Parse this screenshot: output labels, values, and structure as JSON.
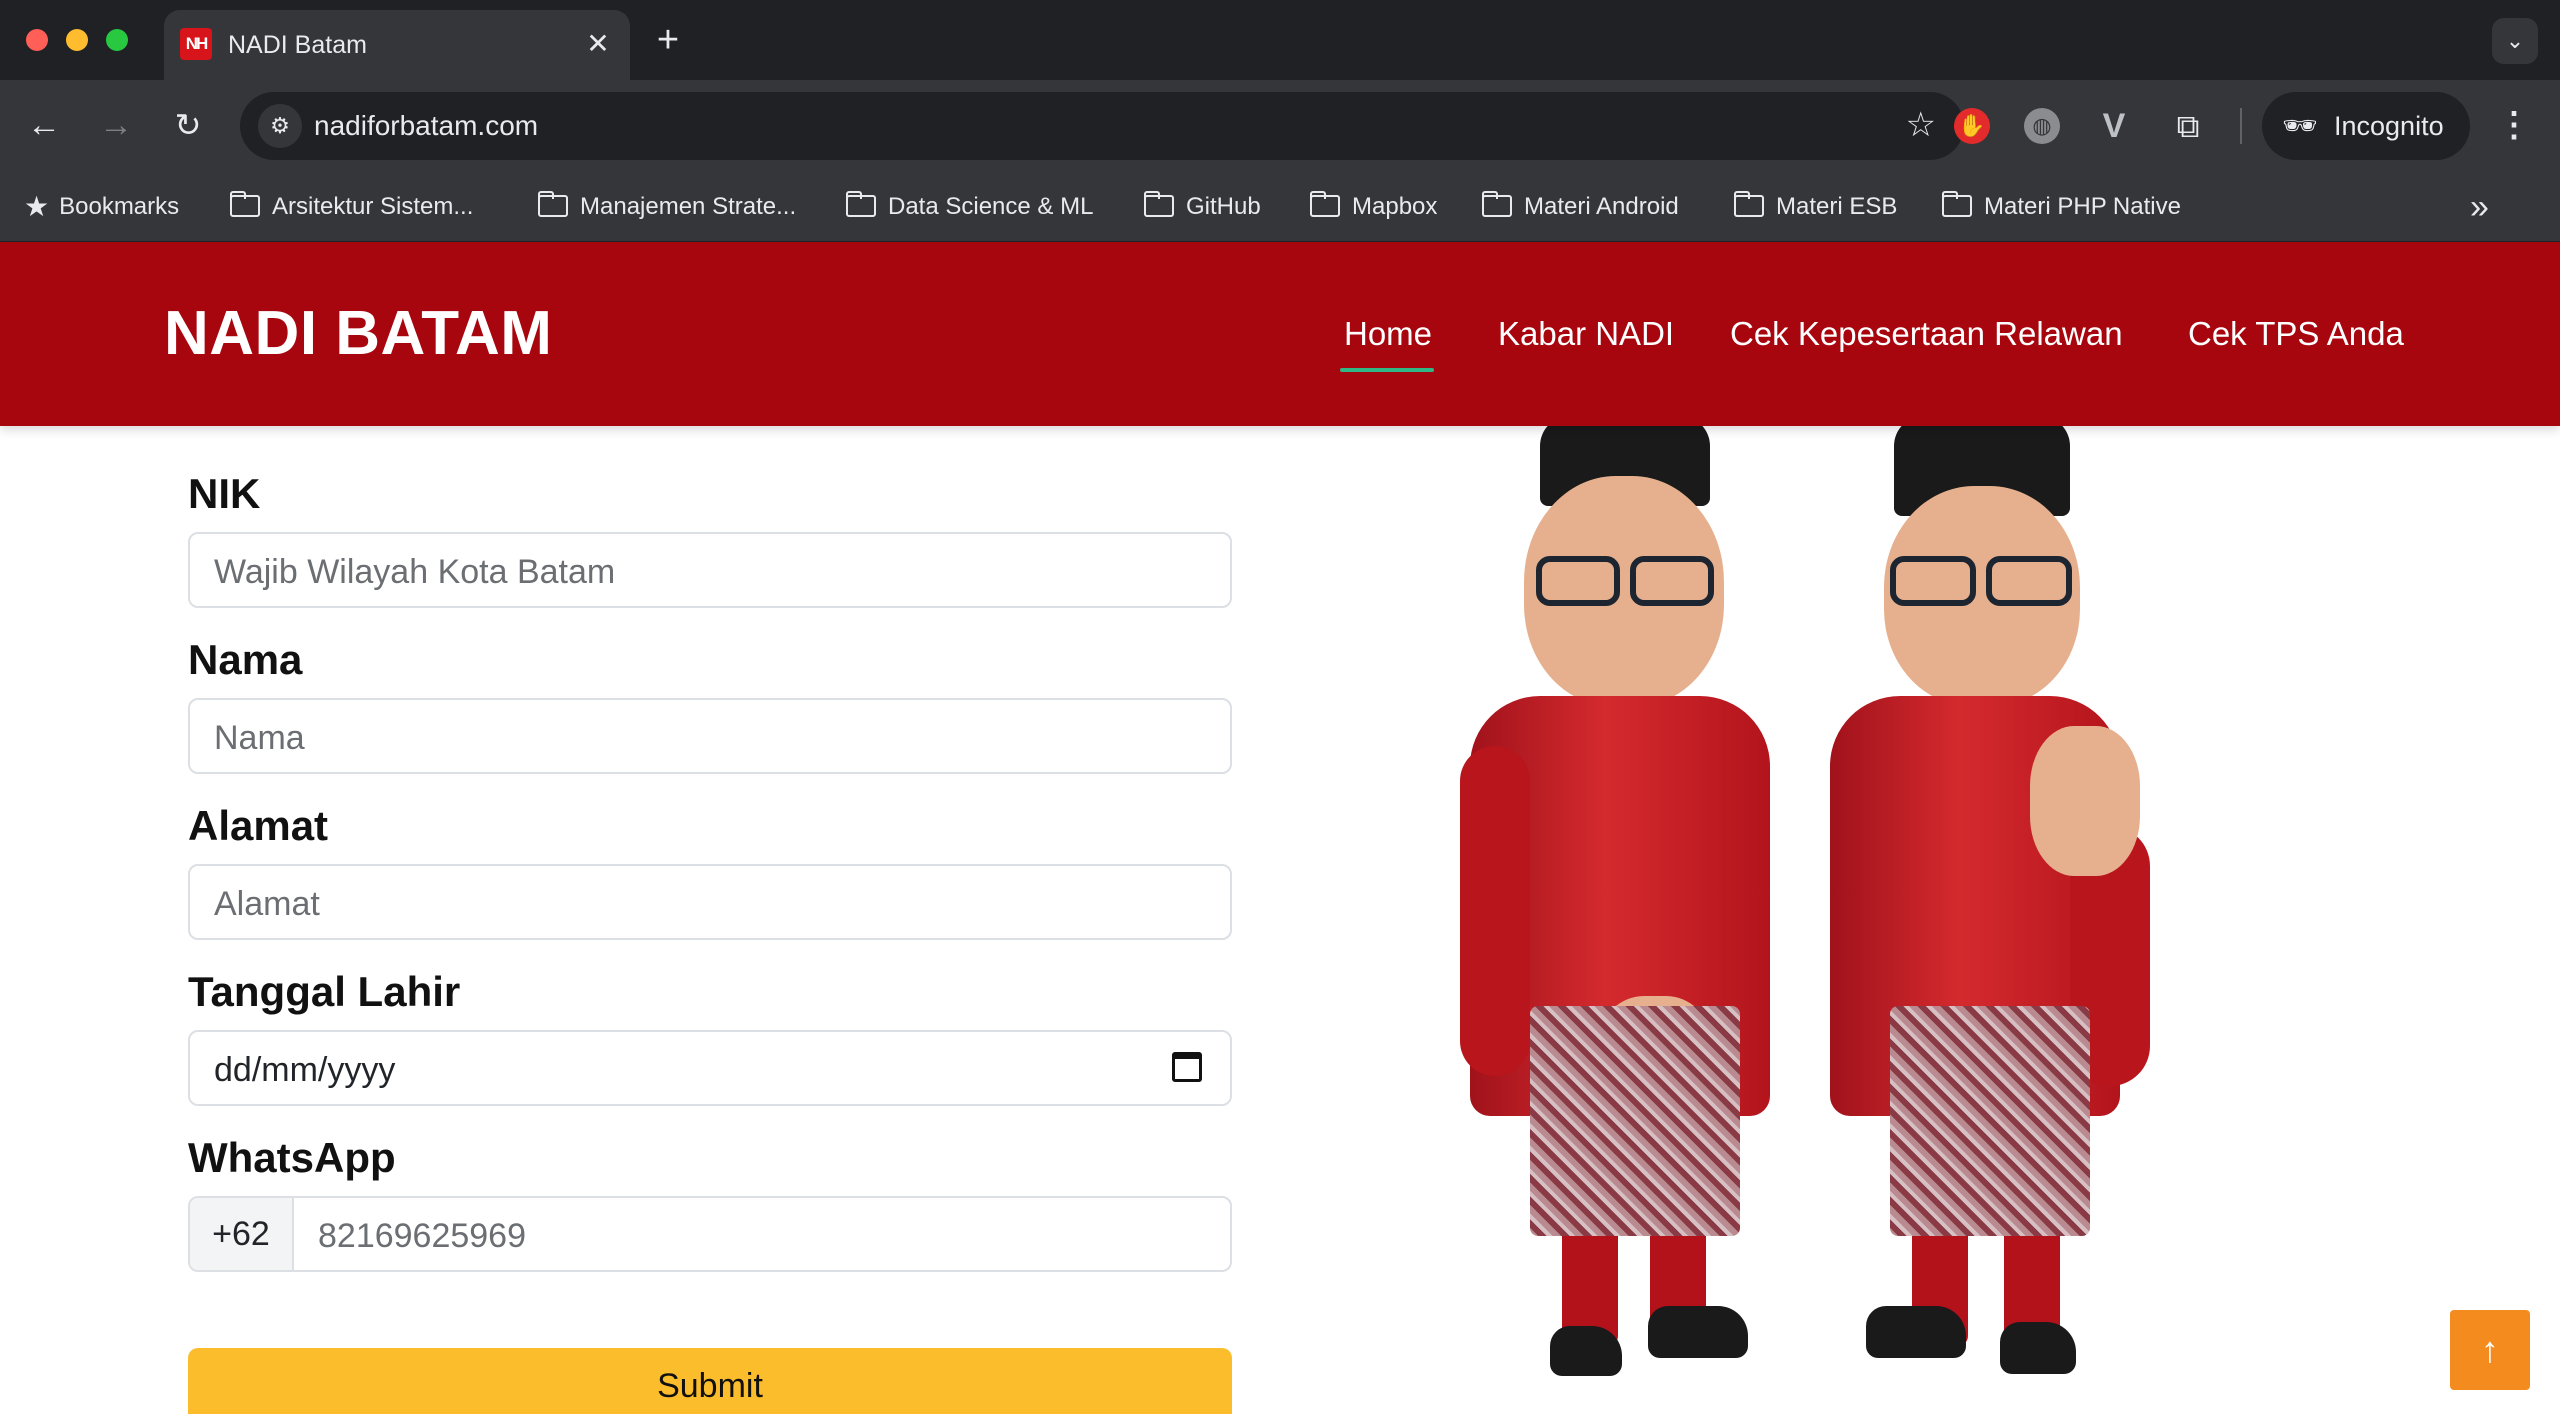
{
  "browser": {
    "tab": {
      "favicon_text": "NH",
      "title": "NADI Batam"
    },
    "url": "nadiforbatam.com",
    "incognito_label": "Incognito",
    "bookmarks": [
      {
        "label": "Bookmarks",
        "icon": "star-icon"
      },
      {
        "label": "Arsitektur Sistem...",
        "icon": "folder-icon"
      },
      {
        "label": "Manajemen Strate...",
        "icon": "folder-icon"
      },
      {
        "label": "Data Science & ML",
        "icon": "folder-icon"
      },
      {
        "label": "GitHub",
        "icon": "folder-icon"
      },
      {
        "label": "Mapbox",
        "icon": "folder-icon"
      },
      {
        "label": "Materi Android",
        "icon": "folder-icon"
      },
      {
        "label": "Materi ESB",
        "icon": "folder-icon"
      },
      {
        "label": "Materi PHP Native",
        "icon": "folder-icon"
      }
    ]
  },
  "site": {
    "brand": "NADI BATAM",
    "nav": [
      {
        "label": "Home",
        "active": true
      },
      {
        "label": "Kabar NADI",
        "active": false
      },
      {
        "label": "Cek Kepesertaan Relawan",
        "active": false
      },
      {
        "label": "Cek TPS Anda",
        "active": false
      }
    ],
    "colors": {
      "header": "#a8060e",
      "submit": "#fbbd2b",
      "active_underline": "#2fb886",
      "scroll_top": "#f48b1f"
    }
  },
  "form": {
    "nik": {
      "label": "NIK",
      "placeholder": "Wajib Wilayah Kota Batam"
    },
    "nama": {
      "label": "Nama",
      "placeholder": "Nama"
    },
    "alamat": {
      "label": "Alamat",
      "placeholder": "Alamat"
    },
    "tanggal_lahir": {
      "label": "Tanggal Lahir",
      "placeholder": "dd/mm/yyyy"
    },
    "whatsapp": {
      "label": "WhatsApp",
      "prefix": "+62",
      "placeholder": "82169625969"
    },
    "submit_label": "Submit"
  }
}
